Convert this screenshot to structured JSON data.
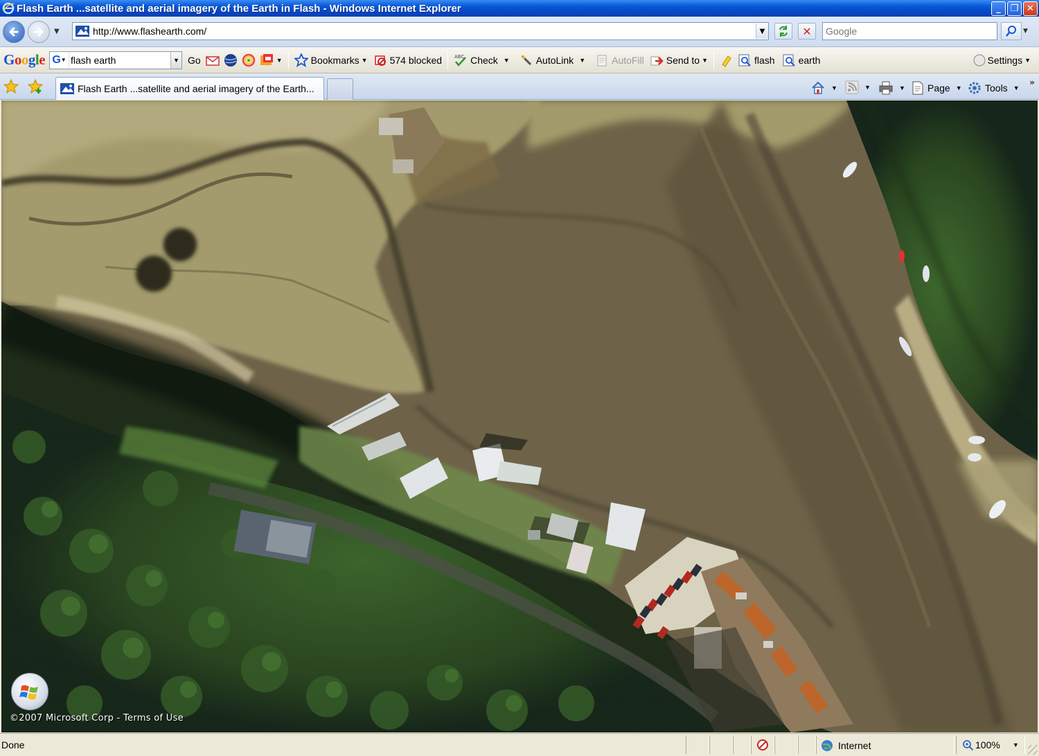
{
  "window": {
    "title": "Flash Earth ...satellite and aerial imagery of the Earth in Flash - Windows Internet Explorer",
    "minimize_glyph": "_",
    "restore_glyph": "❐",
    "close_glyph": "✕"
  },
  "address_bar": {
    "url": "http://www.flashearth.com/",
    "search_placeholder": "Google"
  },
  "google_toolbar": {
    "logo_letters": [
      "G",
      "o",
      "o",
      "g",
      "l",
      "e"
    ],
    "search_value": "flash earth",
    "go_label": "Go",
    "bookmarks_label": "Bookmarks",
    "blocked_label": "574 blocked",
    "check_label": "Check",
    "autolink_label": "AutoLink",
    "autofill_label": "AutoFill",
    "sendto_label": "Send to",
    "flash_label": "flash",
    "earth_label": "earth",
    "settings_label": "Settings"
  },
  "tabs": [
    {
      "label": "Flash Earth ...satellite and aerial imagery of the Earth..."
    }
  ],
  "command_bar": {
    "page_label": "Page",
    "tools_label": "Tools"
  },
  "map": {
    "copyright": "©2007 Microsoft Corp - Terms of Use"
  },
  "status_bar": {
    "status_text": "Done",
    "zone_label": "Internet",
    "zoom_label": "100%"
  },
  "colors": {
    "titlebar": "#0548c7",
    "mudflat": "#6e6348",
    "marsh": "#a39a6d",
    "trees": "#2b4a22"
  },
  "icons": [
    "ie-icon",
    "back-arrow-icon",
    "forward-arrow-icon",
    "page-favicon",
    "refresh-icon",
    "stop-icon",
    "search-icon",
    "favorites-star-icon",
    "add-favorite-icon",
    "home-icon",
    "feeds-icon",
    "print-icon",
    "page-icon",
    "tools-gear-icon",
    "globe-icon",
    "zoom-icon",
    "windows-logo-icon",
    "popup-blocker-icon",
    "spell-check-icon",
    "autolink-icon",
    "autofill-icon",
    "send-to-icon",
    "highlight-icon",
    "search-term-icon",
    "settings-icon"
  ]
}
